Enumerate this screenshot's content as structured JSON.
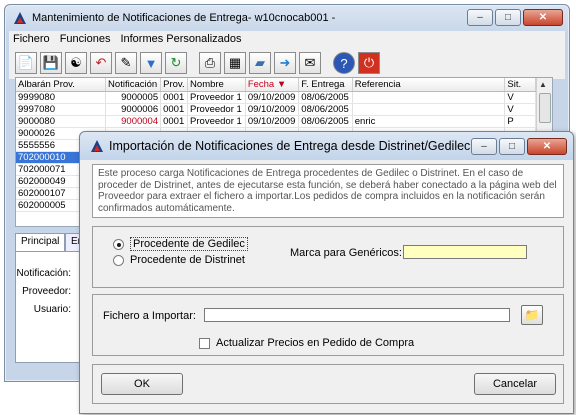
{
  "main_window": {
    "title": "Mantenimiento de Notificaciones de Entrega- w10cnocab001 -",
    "menu": [
      {
        "label": "Fichero"
      },
      {
        "label": "Funciones"
      },
      {
        "label": "Informes Personalizados"
      }
    ],
    "toolbar_icons": [
      "new-document-icon",
      "save-icon",
      "globe-icon",
      "undo-icon",
      "edit-icon",
      "filter-icon",
      "refresh-icon",
      "print-icon",
      "print-preview-icon",
      "export-icon",
      "import-icon",
      "mail-icon",
      "help-icon",
      "power-icon"
    ],
    "grid": {
      "columns": [
        "Albarán Prov.",
        "Notificación",
        "Prov.",
        "Nombre",
        "Fecha",
        "F. Entrega",
        "Referencia",
        "Sit."
      ],
      "sort_column": "Fecha",
      "rows": [
        {
          "albaran": "9999080",
          "notificacion": "9000005",
          "prov": "0001",
          "nombre": "Proveedor 1",
          "fecha": "09/10/2009",
          "entrega": "08/06/2005",
          "ref": "",
          "sit": "V",
          "selected": false
        },
        {
          "albaran": "9997080",
          "notificacion": "9000006",
          "prov": "0001",
          "nombre": "Proveedor 1",
          "fecha": "09/10/2009",
          "entrega": "08/06/2005",
          "ref": "",
          "sit": "V",
          "selected": false
        },
        {
          "albaran": "9000080",
          "notificacion": "9000004",
          "prov": "0001",
          "nombre": "Proveedor 1",
          "fecha": "09/10/2009",
          "entrega": "08/06/2005",
          "ref": "enric",
          "sit": "P",
          "selected": false
        },
        {
          "albaran": "9000026",
          "notificacion": "",
          "prov": "",
          "nombre": "",
          "fecha": "",
          "entrega": "",
          "ref": "",
          "sit": "",
          "selected": false
        },
        {
          "albaran": "5555556",
          "notificacion": "",
          "prov": "",
          "nombre": "",
          "fecha": "",
          "entrega": "",
          "ref": "",
          "sit": "",
          "selected": false
        },
        {
          "albaran": "702000010",
          "notificacion": "",
          "prov": "",
          "nombre": "",
          "fecha": "",
          "entrega": "",
          "ref": "",
          "sit": "",
          "selected": true
        },
        {
          "albaran": "702000071",
          "notificacion": "",
          "prov": "",
          "nombre": "",
          "fecha": "",
          "entrega": "",
          "ref": "",
          "sit": "",
          "selected": false
        },
        {
          "albaran": "602000049",
          "notificacion": "",
          "prov": "",
          "nombre": "",
          "fecha": "",
          "entrega": "",
          "ref": "",
          "sit": "",
          "selected": false
        },
        {
          "albaran": "602000107",
          "notificacion": "",
          "prov": "",
          "nombre": "",
          "fecha": "",
          "entrega": "",
          "ref": "",
          "sit": "",
          "selected": false
        },
        {
          "albaran": "602000005",
          "notificacion": "",
          "prov": "",
          "nombre": "",
          "fecha": "",
          "entrega": "",
          "ref": "",
          "sit": "",
          "selected": false
        }
      ]
    },
    "tabs": [
      {
        "label": "Principal"
      },
      {
        "label": "En"
      }
    ],
    "fields": [
      {
        "label": "Notificación:"
      },
      {
        "label": "Proveedor:"
      },
      {
        "label": "Usuario:"
      }
    ]
  },
  "dialog": {
    "title": "Importación de Notificaciones de Entrega desde Distrinet/Gedilec",
    "info_text": "Este proceso carga Notificaciones de Entrega procedentes de Gedilec o Distrinet. En el caso de proceder de Distrinet, antes de ejecutarse esta función, se deberá haber conectado a la página web del Proveedor para extraer el fichero a importar.Los pedidos de compra incluidos en la notificación serán confirmados automáticamente.",
    "source_options": [
      {
        "label": "Procedente de Gedilec",
        "checked": true
      },
      {
        "label": "Procedente de Distrinet",
        "checked": false
      }
    ],
    "marca_label": "Marca para Genéricos:",
    "marca_value": "",
    "file_label": "Fichero a Importar:",
    "file_value": "",
    "update_prices_label": "Actualizar Precios en Pedido de Compra",
    "update_prices_checked": false,
    "ok_label": "OK",
    "cancel_label": "Cancelar"
  }
}
